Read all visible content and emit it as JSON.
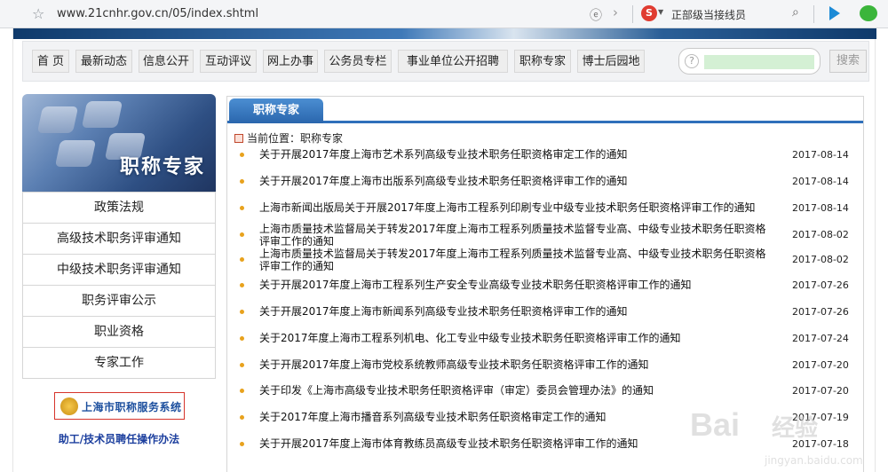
{
  "browser": {
    "url": "www.21cnhr.gov.cn/05/index.shtml",
    "search_engine_icon": "sogou-s-icon",
    "search_text": "正部级当接线员"
  },
  "nav": {
    "items": [
      "首 页",
      "最新动态",
      "信息公开",
      "互动评议",
      "网上办事",
      "公务员专栏",
      "事业单位公开招聘",
      "职称专家",
      "博士后园地"
    ],
    "search_placeholder": "",
    "search_button": "搜索"
  },
  "sidebar": {
    "banner_title": "职称专家",
    "menu": [
      "政策法规",
      "高级技术职务评审通知",
      "中级技术职务评审通知",
      "职务评审公示",
      "职业资格",
      "专家工作"
    ],
    "service_logo": "上海市职称服务系统",
    "bottom_link": "助工/技术员聘任操作办法"
  },
  "main": {
    "tab": "职称专家",
    "breadcrumb": "当前位置：职称专家",
    "news": [
      {
        "title": "关于开展2017年度上海市艺术系列高级专业技术职务任职资格审定工作的通知",
        "date": "2017-08-14"
      },
      {
        "title": "关于开展2017年度上海市出版系列高级专业技术职务任职资格评审工作的通知",
        "date": "2017-08-14"
      },
      {
        "title": "上海市新闻出版局关于开展2017年度上海市工程系列印刷专业中级专业技术职务任职资格评审工作的通知",
        "date": "2017-08-14"
      },
      {
        "title": "上海市质量技术监督局关于转发2017年度上海市工程系列质量技术监督专业高、中级专业技术职务任职资格评审工作的通知",
        "date": "2017-08-02"
      },
      {
        "title": "上海市质量技术监督局关于转发2017年度上海市工程系列质量技术监督专业高、中级专业技术职务任职资格评审工作的通知",
        "date": "2017-08-02"
      },
      {
        "title": "关于开展2017年度上海市工程系列生产安全专业高级专业技术职务任职资格评审工作的通知",
        "date": "2017-07-26"
      },
      {
        "title": "关于开展2017年度上海市新闻系列高级专业技术职务任职资格评审工作的通知",
        "date": "2017-07-26"
      },
      {
        "title": "关于2017年度上海市工程系列机电、化工专业中级专业技术职务任职资格评审工作的通知",
        "date": "2017-07-24"
      },
      {
        "title": "关于开展2017年度上海市党校系统教师高级专业技术职务任职资格评审工作的通知",
        "date": "2017-07-20"
      },
      {
        "title": "关于印发《上海市高级专业技术职务任职资格评审（审定）委员会管理办法》的通知",
        "date": "2017-07-20"
      },
      {
        "title": "关于2017年度上海市播音系列高级专业技术职务任职资格审定工作的通知",
        "date": "2017-07-19"
      },
      {
        "title": "关于开展2017年度上海市体育教练员高级专业技术职务任职资格评审工作的通知",
        "date": "2017-07-18"
      }
    ]
  },
  "watermark": {
    "brand": "Bai",
    "text": "经验",
    "url": "jingyan.baidu.com"
  },
  "colors": {
    "tab_blue": "#2f6fba",
    "bullet": "#e8a21d",
    "link_blue": "#1c3f9e",
    "logo_red": "#d6342b"
  }
}
